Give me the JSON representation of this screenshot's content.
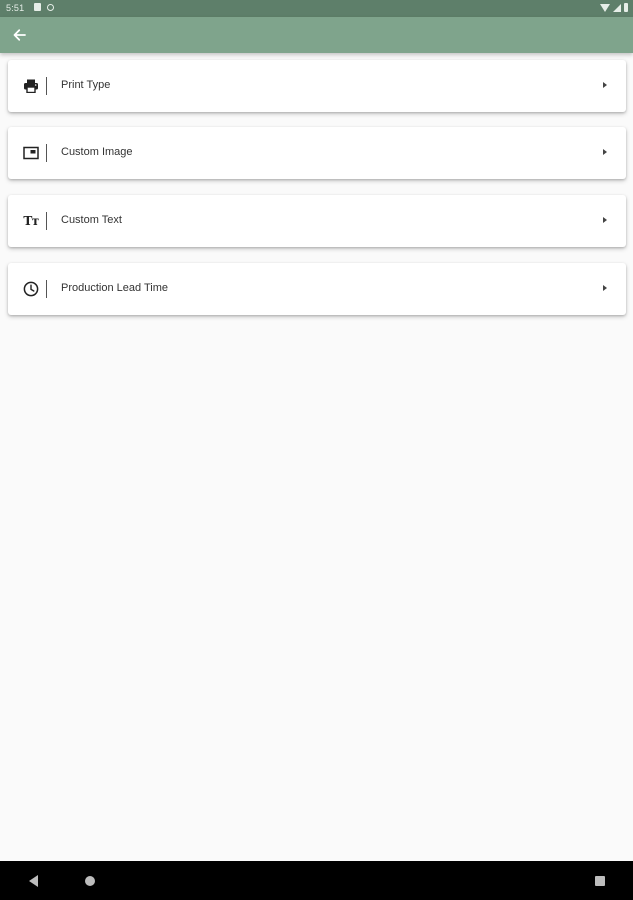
{
  "status_bar": {
    "time": "5:51",
    "left_icons": [
      "sd-card-icon",
      "sync-icon"
    ],
    "right_icons": [
      "wifi-icon",
      "signal-icon",
      "battery-icon"
    ]
  },
  "app_bar": {
    "back_icon": "arrow-left-icon",
    "background_color": "#7fa48c"
  },
  "menu": {
    "items": [
      {
        "label": "Print Type",
        "icon": "printer-icon"
      },
      {
        "label": "Custom Image",
        "icon": "image-icon"
      },
      {
        "label": "Custom Text",
        "icon": "text-size-icon"
      },
      {
        "label": "Production Lead Time",
        "icon": "clock-icon"
      }
    ]
  },
  "nav_bar": {
    "buttons": [
      "back",
      "home",
      "recents"
    ]
  }
}
